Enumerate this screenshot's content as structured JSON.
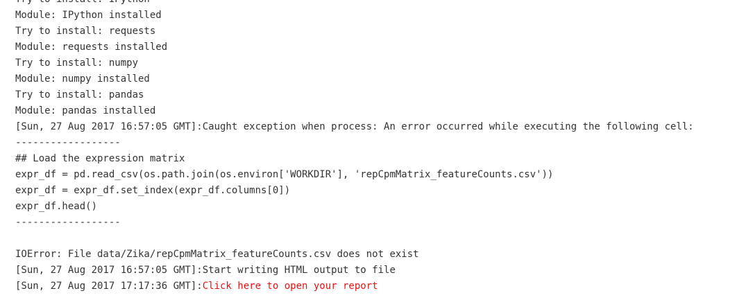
{
  "log": {
    "lines": [
      "Try to install: IPython",
      "Module: IPython installed",
      "Try to install: requests",
      "Module: requests installed",
      "Try to install: numpy",
      "Module: numpy installed",
      "Try to install: pandas",
      "Module: pandas installed",
      "[Sun, 27 Aug 2017 16:57:05 GMT]:Caught exception when process: An error occurred while executing the following cell:",
      "------------------",
      "## Load the expression matrix",
      "expr_df = pd.read_csv(os.path.join(os.environ['WORKDIR'], 'repCpmMatrix_featureCounts.csv'))",
      "expr_df = expr_df.set_index(expr_df.columns[0])",
      "expr_df.head()",
      "------------------",
      "",
      "IOError: File data/Zika/repCpmMatrix_featureCounts.csv does not exist",
      "[Sun, 27 Aug 2017 16:57:05 GMT]:Start writing HTML output to file"
    ],
    "last_line_prefix": "[Sun, 27 Aug 2017 17:17:36 GMT]:",
    "report_link_text": "Click here to open your report"
  },
  "colors": {
    "text": "#333333",
    "link": "#ee1111",
    "background": "#ffffff"
  }
}
